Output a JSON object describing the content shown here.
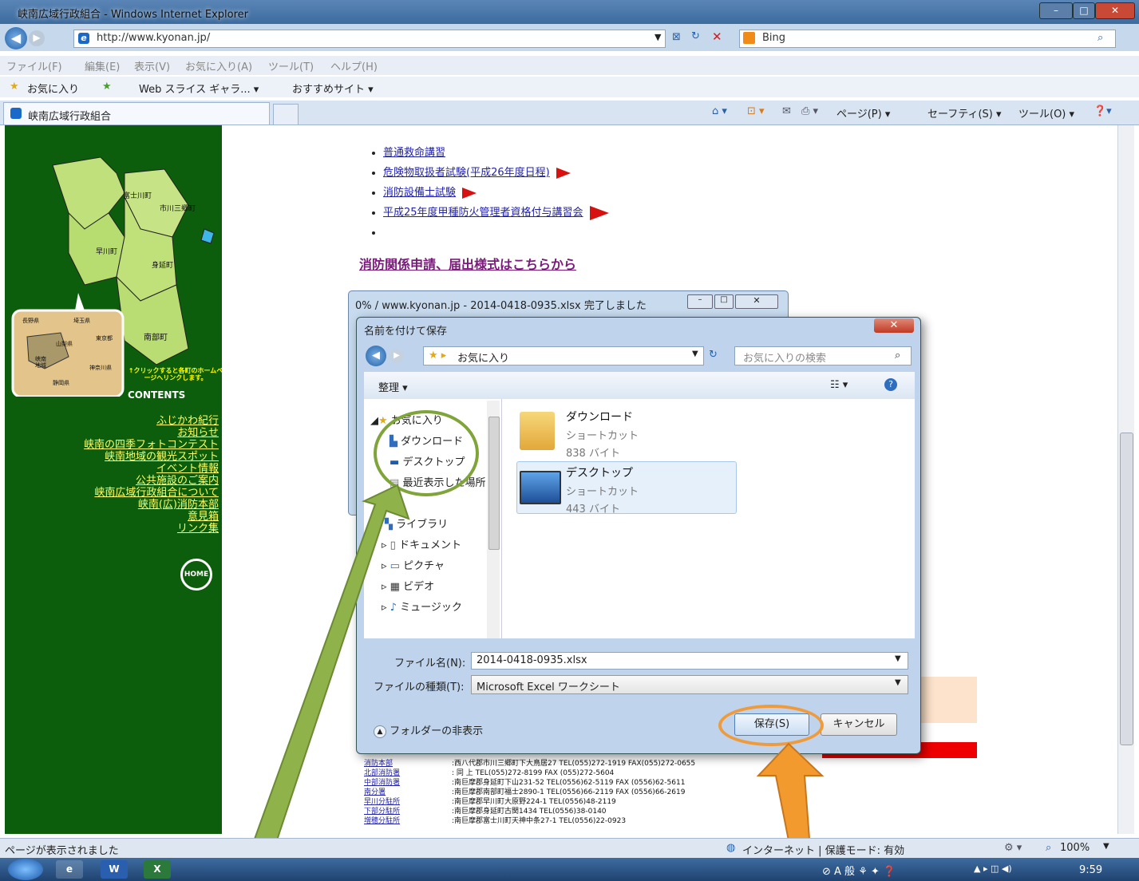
{
  "window": {
    "title": "峡南広域行政組合 - Windows Internet Explorer"
  },
  "browser": {
    "url": "http://www.kyonan.jp/",
    "search_engine": "Bing",
    "menu": [
      "ファイル(F)",
      "編集(E)",
      "表示(V)",
      "お気に入り(A)",
      "ツール(T)",
      "ヘルプ(H)"
    ],
    "favorites_label": "お気に入り",
    "fav_items": [
      "Web スライス ギャラ... ▾",
      "おすすめサイト ▾"
    ],
    "tab_title": "峡南広域行政組合",
    "commands": [
      "ページ(P) ▾",
      "セーフティ(S) ▾",
      "ツール(O) ▾"
    ]
  },
  "sidebar": {
    "map_towns": [
      "富士川町",
      "市川三郷町",
      "早川町",
      "身延町",
      "南部町"
    ],
    "map_prefectures": [
      "長野県",
      "埼玉県",
      "東京都",
      "山梨県",
      "神奈川県",
      "静岡県"
    ],
    "map_inset_label": "峡南地域",
    "click_note": "↑クリックすると各町のホームページへリンクします。",
    "contents_title": "CONTENTS",
    "links": [
      "ふじかわ紀行",
      "お知らせ",
      "峡南の四季フォトコンテスト",
      "峡南地域の観光スポット",
      "イベント情報",
      "公共施設のご案内",
      "峡南広域行政組合について",
      "峡南(広)消防本部",
      "意見箱",
      "リンク集"
    ],
    "home_label": "HOME"
  },
  "page": {
    "list": [
      "普通救命講習",
      "危険物取扱者試験(平成26年度日程)",
      "消防設備士試験",
      "平成25年度甲種防火管理者資格付与講習会",
      ""
    ],
    "forms_link": "消防関係申請、届出様式はこちらから",
    "offices": [
      {
        "name": "消防本部",
        "detail": ":西八代郡市川三郷町下大鳥居27 TEL(055)272-1919 FAX(055)272-0655"
      },
      {
        "name": "北部消防署",
        "detail": ": 同 上 TEL(055)272-8199 FAX (055)272-5604"
      },
      {
        "name": "中部消防署",
        "detail": ":南巨摩郡身延町下山231-52 TEL(0556)62-5119 FAX (0556)62-5611"
      },
      {
        "name": "南分署",
        "detail": ":南巨摩郡南部町福士2890-1 TEL(0556)66-2119 FAX (0556)66-2619"
      },
      {
        "name": "早川分駐所",
        "detail": ":南巨摩郡早川町大原野224-1 TEL(0556)48-2119"
      },
      {
        "name": "下部分駐所",
        "detail": ":南巨摩郡身延町古関1434 TEL(0556)38-0140"
      },
      {
        "name": "増穂分駐所",
        "detail": ":南巨摩郡富士川町天神中条27-1 TEL(0556)22-0923"
      }
    ]
  },
  "download": {
    "title": "0% / www.kyonan.jp - 2014-0418-0935.xlsx 完了しました"
  },
  "dialog": {
    "title": "名前を付けて保存",
    "path": "お気に入り",
    "search_placeholder": "お気に入りの検索",
    "organize": "整理 ▾",
    "nav": [
      "お気に入り",
      "ダウンロード",
      "デスクトップ",
      "最近表示した場所",
      "ライブラリ",
      "ドキュメント",
      "ピクチャ",
      "ビデオ",
      "ミュージック"
    ],
    "files": [
      {
        "name": "ダウンロード",
        "type": "ショートカット",
        "size": "838 バイト"
      },
      {
        "name": "デスクトップ",
        "type": "ショートカット",
        "size": "443 バイト"
      }
    ],
    "filename_label": "ファイル名(N):",
    "filename": "2014-0418-0935.xlsx",
    "filetype_label": "ファイルの種類(T):",
    "filetype": "Microsoft Excel ワークシート",
    "hide_folders": "フォルダーの非表示",
    "save": "保存(S)",
    "cancel": "キャンセル"
  },
  "statusbar": {
    "text": "ページが表示されました",
    "zone": "インターネット | 保護モード: 有効",
    "zoom": "100%"
  },
  "taskbar": {
    "ime": "A 般",
    "time": "9:59"
  }
}
